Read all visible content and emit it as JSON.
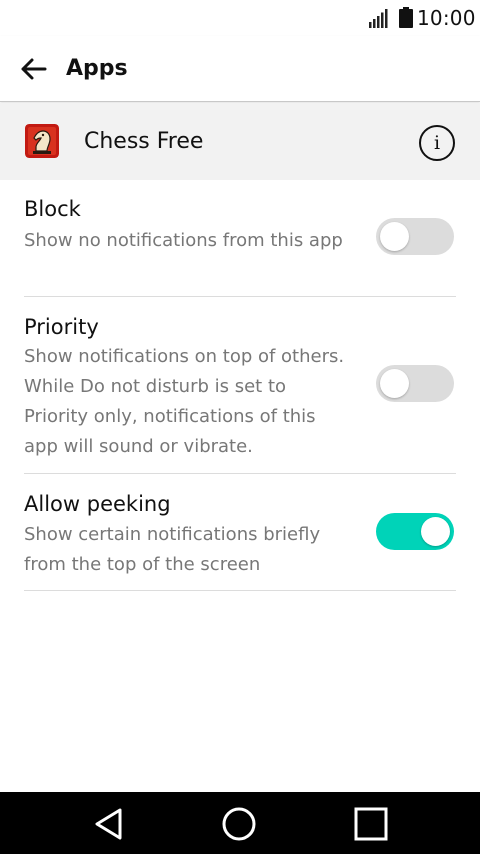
{
  "status_bar": {
    "time": "10:00",
    "signal_icon": "signal-bars-icon",
    "battery_icon": "battery-icon"
  },
  "app_bar": {
    "title": "Apps",
    "back_icon": "arrow-back-icon"
  },
  "app_header": {
    "app_name": "Chess Free",
    "app_icon": "chess-knight-icon",
    "info_icon": "info-icon"
  },
  "settings": [
    {
      "title": "Block",
      "description": "Show no notifications from this app",
      "enabled": false
    },
    {
      "title": "Priority",
      "description": "Show notifications on top of others. While Do not disturb is set to Priority only, notifications of this app will sound or vibrate.",
      "enabled": false
    },
    {
      "title": "Allow peeking",
      "description": "Show certain notifications briefly from the top of the screen",
      "enabled": true
    }
  ],
  "nav_bar": {
    "back_icon": "triangle-back-icon",
    "home_icon": "circle-home-icon",
    "recents_icon": "square-recents-icon"
  },
  "colors": {
    "toggle_on": "#00d3b8",
    "toggle_off": "#dcdcdc",
    "header_bg": "#f2f2f2"
  }
}
